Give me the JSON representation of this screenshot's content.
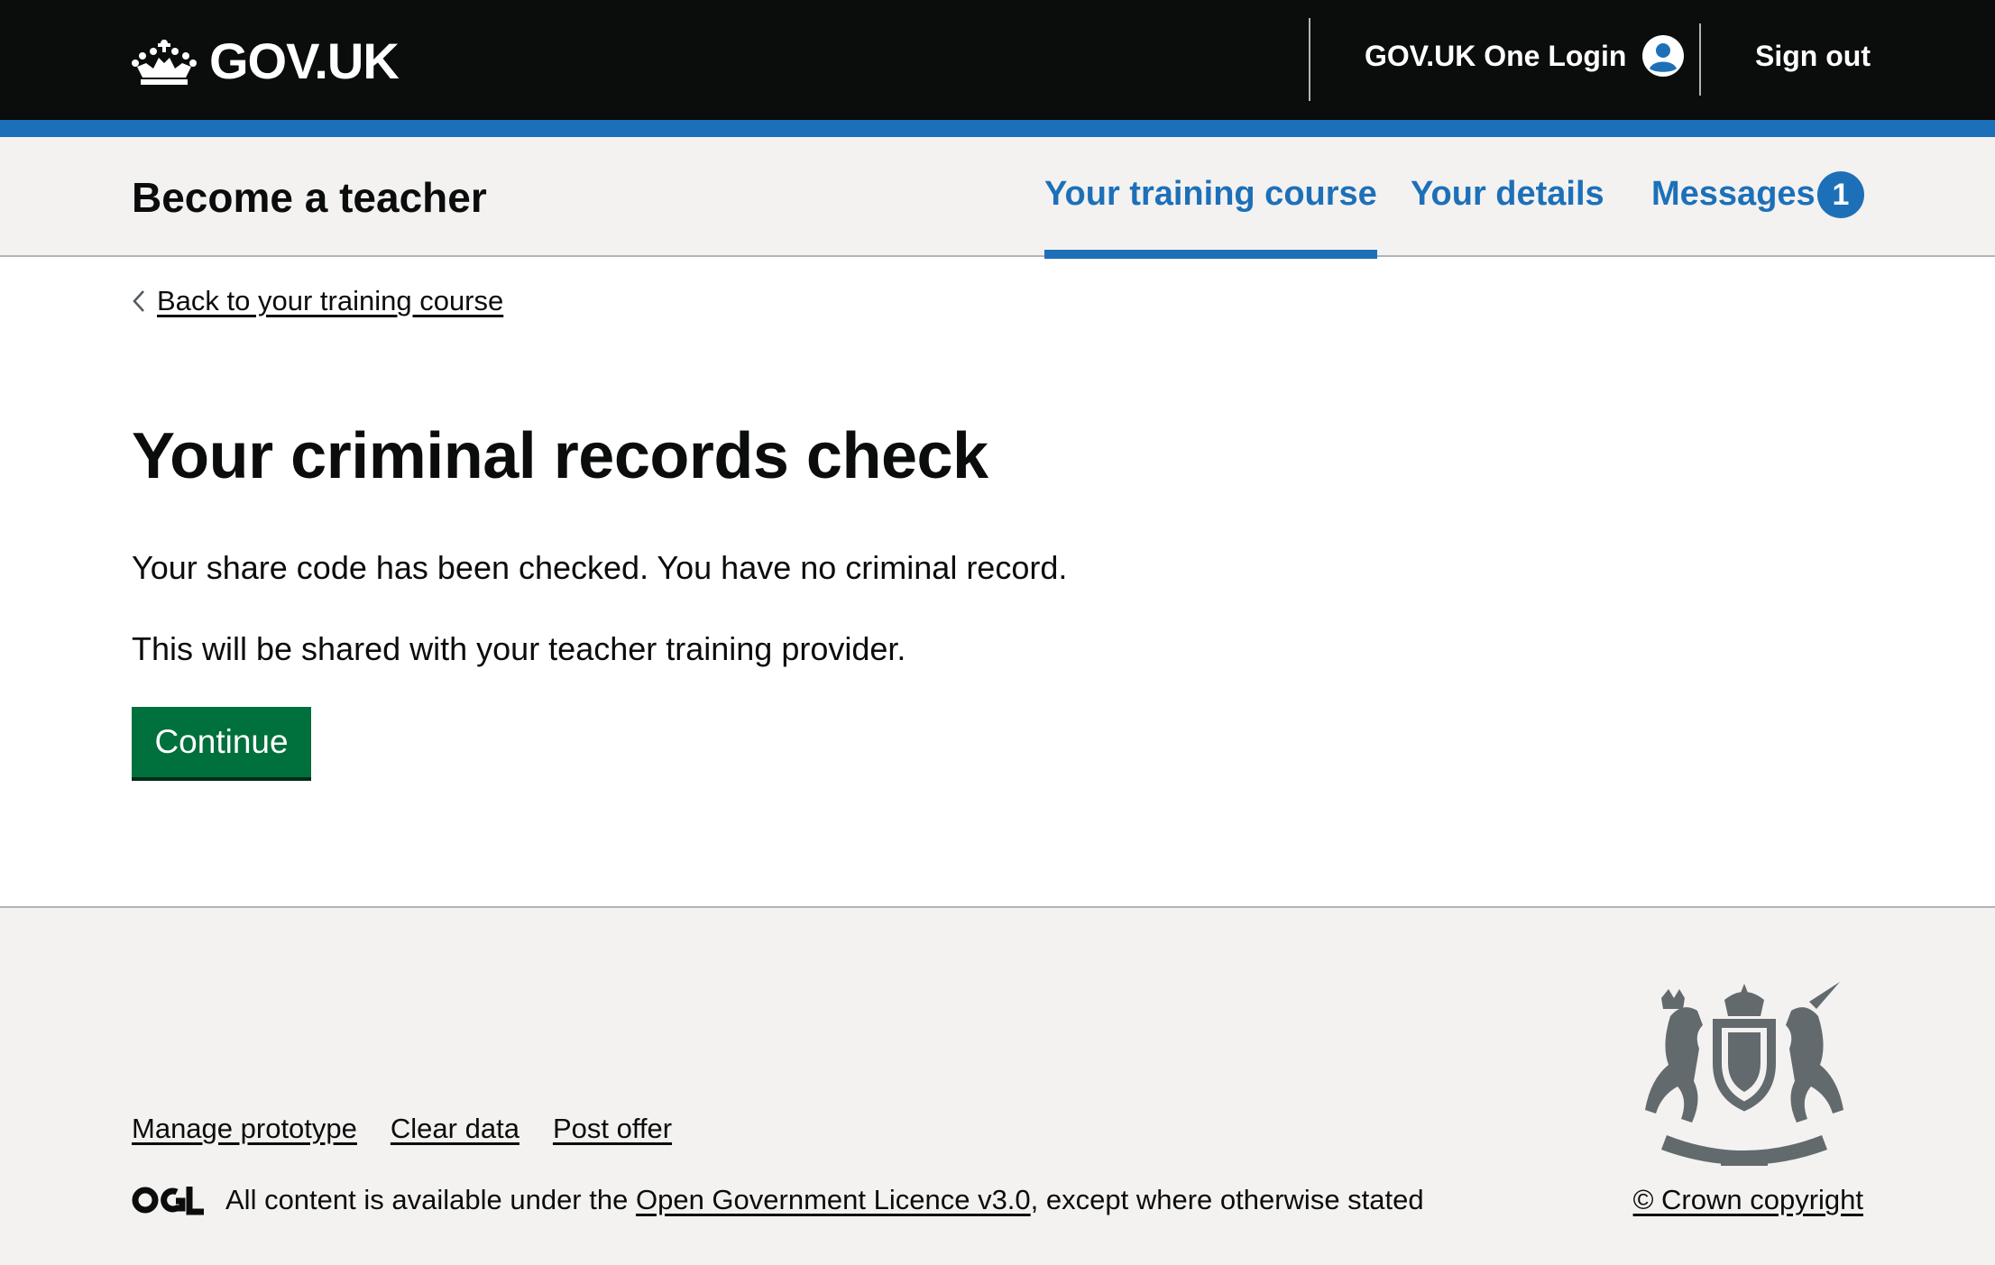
{
  "header": {
    "logo_text": "GOV.UK",
    "one_login_label": "GOV.UK One Login",
    "sign_out_label": "Sign out"
  },
  "service_nav": {
    "service_name": "Become a teacher",
    "items": [
      {
        "label": "Your training course",
        "active": true
      },
      {
        "label": "Your details",
        "active": false
      },
      {
        "label": "Messages",
        "active": false,
        "badge": "1"
      }
    ]
  },
  "main": {
    "back_link": "Back to your training course",
    "title": "Your criminal records check",
    "paragraphs": [
      "Your share code has been checked. You have no criminal record.",
      "This will be shared with your teacher training provider."
    ],
    "continue_label": "Continue"
  },
  "footer": {
    "links": [
      "Manage prototype",
      "Clear data",
      "Post offer"
    ],
    "licence_prefix": "All content is available under the",
    "licence_link": "Open Government Licence v3.0",
    "licence_suffix": ", except where otherwise stated",
    "copyright": "© Crown copyright"
  },
  "colors": {
    "header_bg": "#0b0c0c",
    "brand_blue": "#1d70b8",
    "button_green": "#00703c",
    "footer_bg": "#f3f2f1",
    "crest_grey": "#626a6e"
  }
}
